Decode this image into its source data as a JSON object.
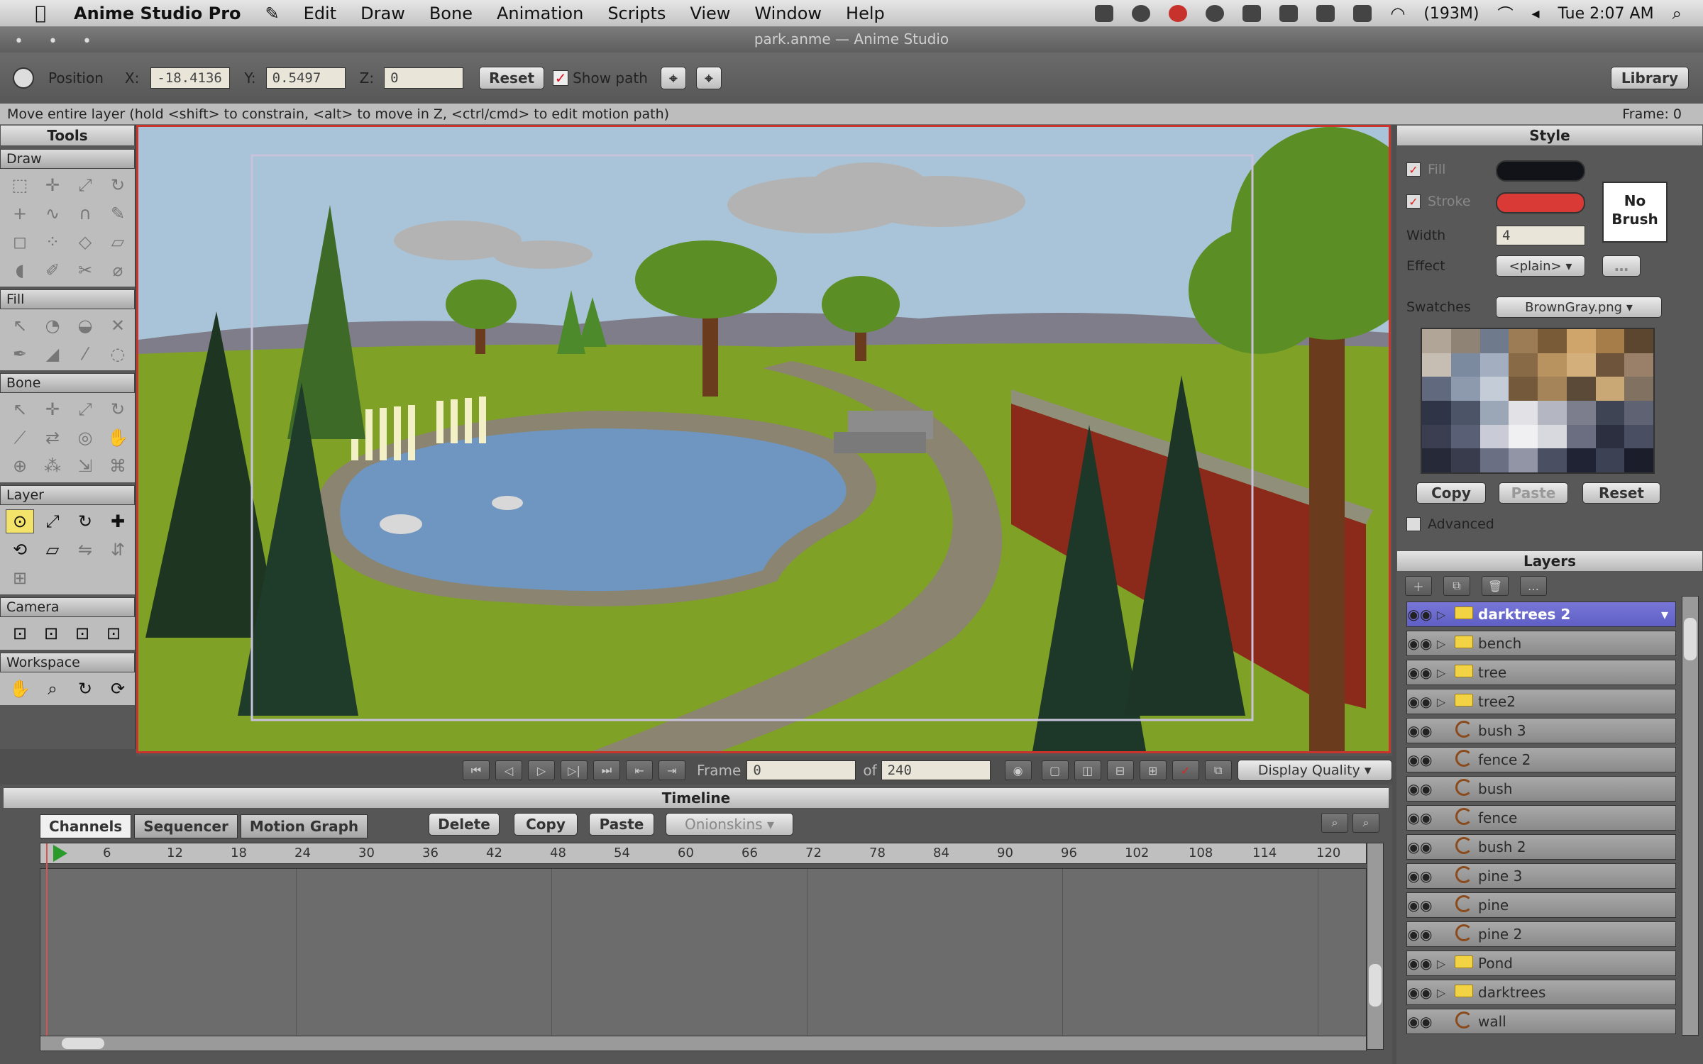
{
  "menubar": {
    "app": "Anime Studio Pro",
    "items": [
      "Edit",
      "Draw",
      "Bone",
      "Animation",
      "Scripts",
      "View",
      "Window",
      "Help"
    ],
    "memory": "(193M)",
    "clock": "Tue 2:07 AM"
  },
  "window": {
    "title": "park.anme — Anime Studio"
  },
  "tool_options": {
    "position_label": "Position",
    "x_label": "X:",
    "x_value": "-18.4136",
    "y_label": "Y:",
    "y_value": "0.5497",
    "z_label": "Z:",
    "z_value": "0",
    "reset": "Reset",
    "show_path": "Show path",
    "library": "Library"
  },
  "hint": {
    "text": "Move entire layer (hold <shift> to constrain, <alt> to move in Z, <ctrl/cmd> to edit motion path)",
    "frame": "Frame: 0"
  },
  "tools": {
    "title": "Tools",
    "sections": [
      "Draw",
      "Fill",
      "Bone",
      "Layer",
      "Camera",
      "Workspace"
    ]
  },
  "transport": {
    "frame_label": "Frame",
    "frame_value": "0",
    "of_label": "of",
    "total_frames": "240",
    "quality": "Display Quality"
  },
  "style": {
    "title": "Style",
    "fill_label": "Fill",
    "stroke_label": "Stroke",
    "width_label": "Width",
    "width_value": "4",
    "effect_label": "Effect",
    "effect_value": "<plain>",
    "no_brush": "No Brush",
    "swatches_label": "Swatches",
    "swatches_value": "BrownGray.png",
    "copy": "Copy",
    "paste": "Paste",
    "reset": "Reset",
    "advanced": "Advanced",
    "fill_color": "#111318",
    "stroke_color": "#d93a36"
  },
  "layers": {
    "title": "Layers",
    "items": [
      {
        "name": "darktrees 2",
        "type": "folder"
      },
      {
        "name": "bench",
        "type": "folder"
      },
      {
        "name": "tree",
        "type": "folder"
      },
      {
        "name": "tree2",
        "type": "folder"
      },
      {
        "name": "bush 3",
        "type": "vector"
      },
      {
        "name": "fence 2",
        "type": "vector"
      },
      {
        "name": "bush",
        "type": "vector"
      },
      {
        "name": "fence",
        "type": "vector"
      },
      {
        "name": "bush 2",
        "type": "vector"
      },
      {
        "name": "pine 3",
        "type": "vector"
      },
      {
        "name": "pine",
        "type": "vector"
      },
      {
        "name": "pine 2",
        "type": "vector"
      },
      {
        "name": "Pond",
        "type": "folder"
      },
      {
        "name": "darktrees",
        "type": "folder"
      },
      {
        "name": "wall",
        "type": "vector"
      }
    ]
  },
  "timeline": {
    "title": "Timeline",
    "tabs": [
      "Channels",
      "Sequencer",
      "Motion Graph"
    ],
    "delete": "Delete",
    "copy": "Copy",
    "paste": "Paste",
    "onionskins": "Onionskins",
    "ruler": [
      "6",
      "12",
      "18",
      "24",
      "30",
      "36",
      "42",
      "48",
      "54",
      "60",
      "66",
      "72",
      "78",
      "84",
      "90",
      "96",
      "102",
      "108",
      "114",
      "120"
    ]
  },
  "colors": {
    "selection": "#6a69d0",
    "accent_red": "#c9352d"
  }
}
